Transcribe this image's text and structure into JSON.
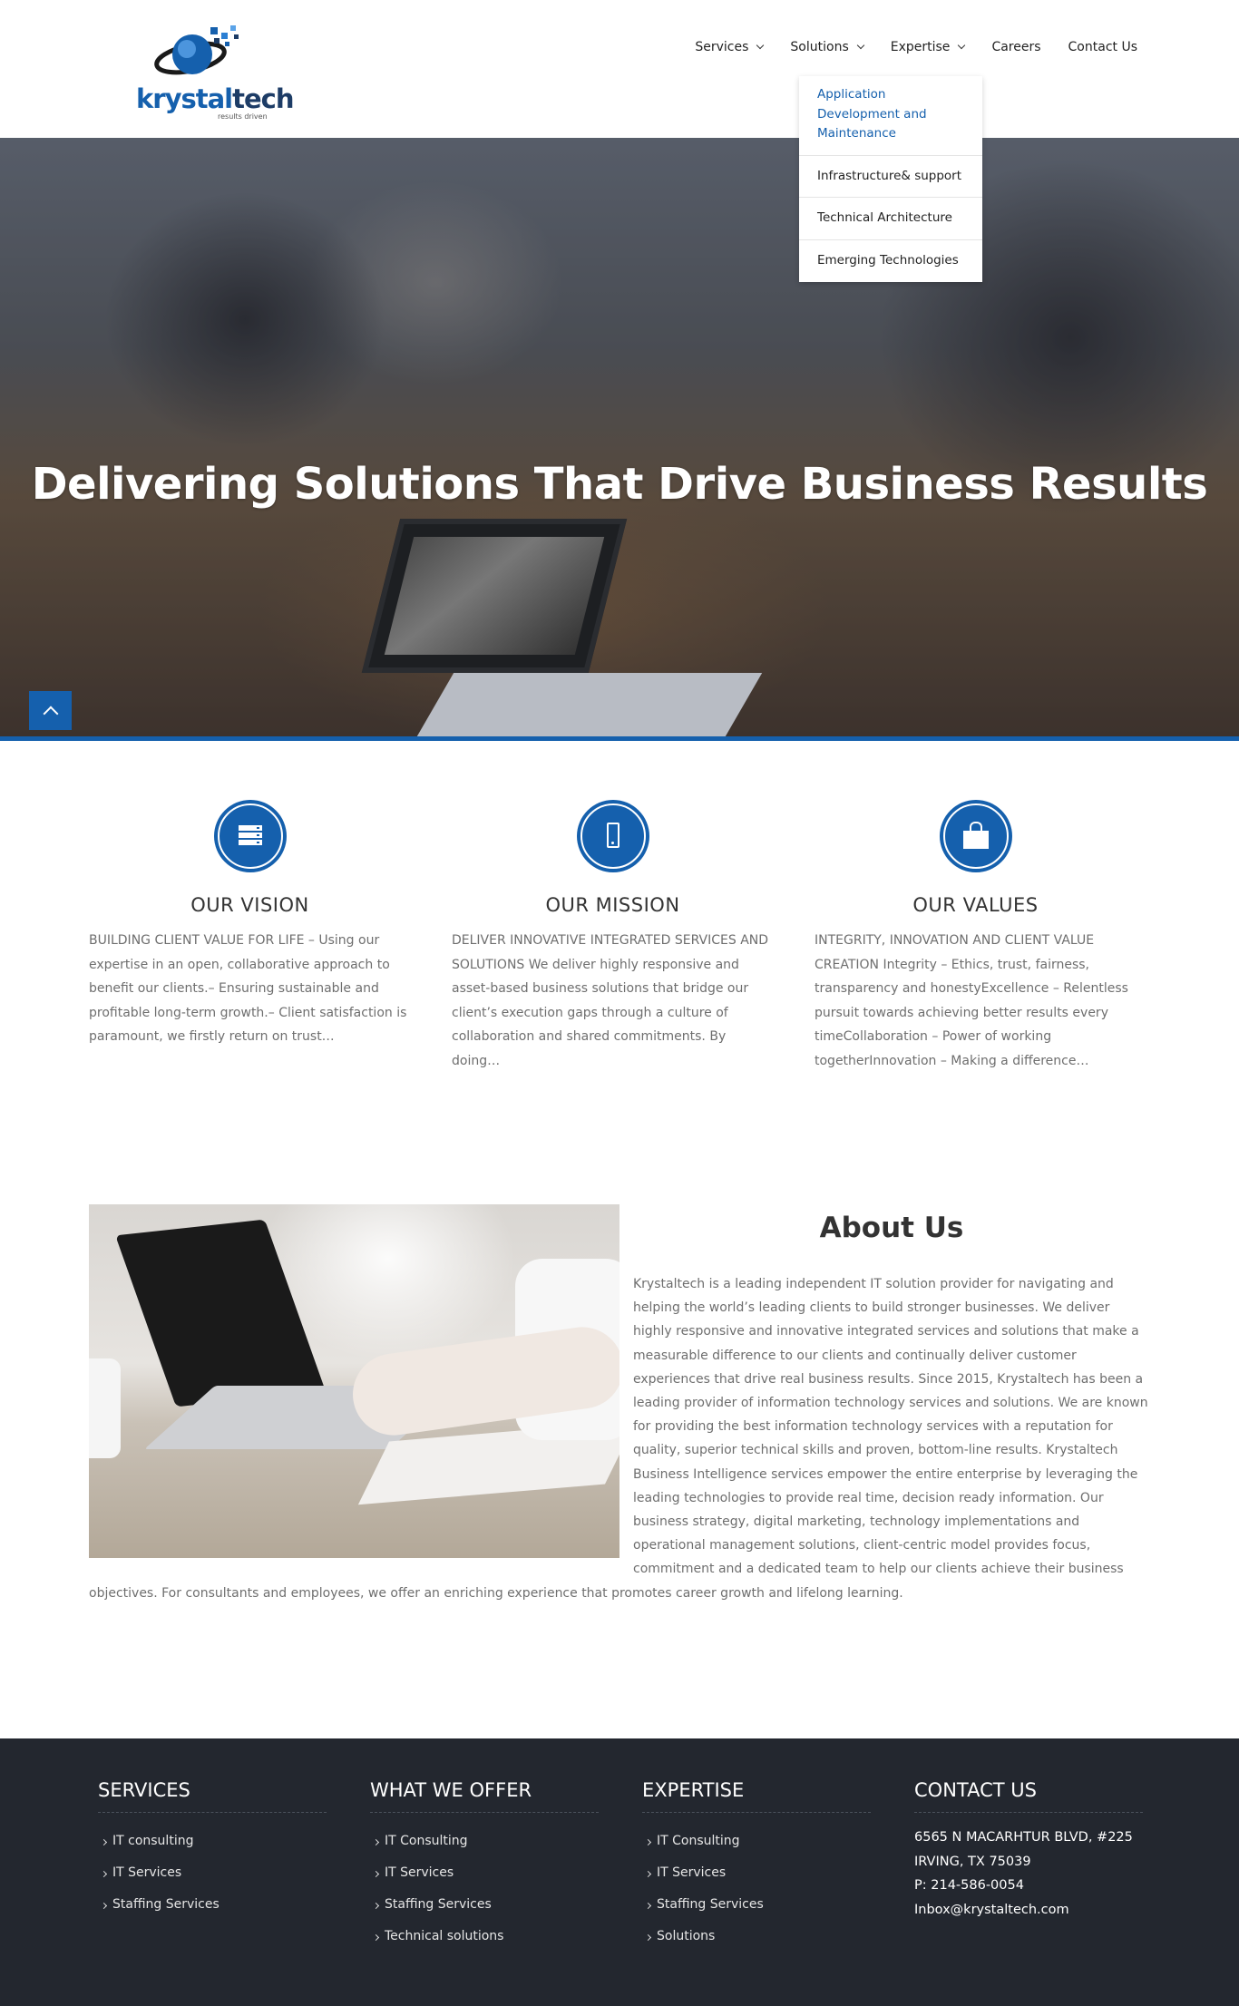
{
  "brand": {
    "name_part1": "krystal",
    "name_part2": "tech",
    "tagline": "results driven",
    "accent_color": "#1560ad",
    "dark_color": "#1d3c66"
  },
  "nav": {
    "items": [
      {
        "label": "Services",
        "has_dropdown": true
      },
      {
        "label": "Solutions",
        "has_dropdown": true
      },
      {
        "label": "Expertise",
        "has_dropdown": true
      },
      {
        "label": "Careers",
        "has_dropdown": false
      },
      {
        "label": "Contact Us",
        "has_dropdown": false
      }
    ],
    "open_dropdown": {
      "parent": "Solutions",
      "items": [
        "Application Development and Maintenance",
        "Infrastructure& support",
        "Technical Architecture",
        "Emerging Technologies"
      ]
    }
  },
  "hero": {
    "title": "Delivering Solutions That Drive Business Results",
    "scroll_top_icon": "chevron-up-icon"
  },
  "features": [
    {
      "icon": "server-icon",
      "title": "OUR VISION",
      "text": "BUILDING CLIENT VALUE FOR LIFE – Using our expertise in an open, collaborative approach to benefit our clients.– Ensuring sustainable and profitable long-term growth.– Client satisfaction is paramount, we firstly return on trust…"
    },
    {
      "icon": "mobile-icon",
      "title": "OUR MISSION",
      "text": "DELIVER INNOVATIVE INTEGRATED SERVICES AND SOLUTIONS We deliver highly responsive and asset-based business solutions that bridge our client’s execution gaps through a culture of collaboration and shared commitments. By doing…"
    },
    {
      "icon": "shopping-bag-icon",
      "title": "OUR VALUES",
      "text": "INTEGRITY, INNOVATION AND CLIENT VALUE CREATION Integrity – Ethics, trust, fairness, transparency and honestyExcellence – Relentless pursuit towards achieving better results every timeCollaboration – Power of working togetherInnovation – Making a difference…"
    }
  ],
  "about": {
    "title": "About Us",
    "text": "Krystaltech is a leading independent IT solution provider for navigating and helping the world’s leading clients to build stronger businesses. We deliver highly responsive and innovative integrated services and solutions that make a measurable difference to our clients and continually deliver customer experiences that drive real business results. Since 2015, Krystaltech has been a leading provider of information technology services and solutions. We are known for providing the best information technology services with a reputation for quality, superior technical skills and proven, bottom-line results. Krystaltech Business Intelligence services empower the entire enterprise by leveraging the leading technologies to provide real time, decision ready information. Our business strategy, digital marketing, technology implementations and operational management solutions, client-centric model provides focus, commitment and a dedicated team to help our clients achieve their business objectives. For consultants and employees, we offer an enriching experience that promotes career growth and lifelong learning."
  },
  "footer": {
    "background_color": "#23272f",
    "columns": [
      {
        "title": "SERVICES",
        "links": [
          "IT consulting",
          "IT Services",
          "Staffing Services"
        ]
      },
      {
        "title": "WHAT WE OFFER",
        "links": [
          "IT Consulting",
          "IT Services",
          "Staffing Services",
          "Technical solutions"
        ]
      },
      {
        "title": "EXPERTISE",
        "links": [
          "IT Consulting",
          "IT Services",
          "Staffing Services",
          "Solutions"
        ]
      }
    ],
    "contact": {
      "title": "CONTACT US",
      "lines": [
        "6565 N MACARHTUR BLVD, #225",
        "IRVING, TX 75039",
        "P: 214-586-0054",
        "Inbox@krystaltech.com"
      ]
    }
  }
}
